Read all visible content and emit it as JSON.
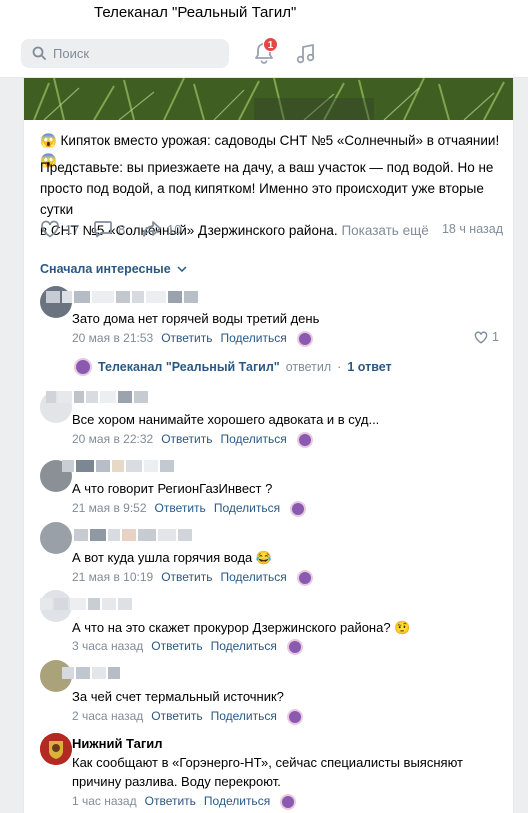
{
  "window": {
    "title": "Телеканал \"Реальный Тагил\""
  },
  "header": {
    "search_placeholder": "Поиск",
    "notifications_count": "1",
    "icons": [
      "search-icon",
      "bell-icon",
      "music-icon"
    ]
  },
  "post": {
    "title": "😱 Кипяток вместо урожая: садоводы СНТ №5 «Солнечный» в отчаянии! 😱",
    "body_line1": "Представьте: вы приезжаете на дачу, а ваш участок — под водой. Но не",
    "body_line2": "просто под водой, а под кипятком! Именно это происходит уже вторые сутки",
    "body_line3": "в СНТ №5 «Солнечный» Дзержинского района.",
    "more": "Показать ещё",
    "likes": "17",
    "comments": "8",
    "shares": "10",
    "time": "18 ч назад"
  },
  "comments_header": {
    "sort_label": "Сначала интересные"
  },
  "labels": {
    "reply": "Ответить",
    "share": "Поделиться"
  },
  "comments": [
    {
      "text": "Зато дома нет горячей воды третий день",
      "date": "20 мая в 21:53",
      "likes": "1"
    },
    {
      "text": "Все хором нанимайте хорошего адвоката и в суд...",
      "date": "20 мая в 22:32"
    },
    {
      "text": "А что говорит РегионГазИнвест ?",
      "date": "21 мая в 9:52"
    },
    {
      "text": "А вот куда ушла горячия вода 😂",
      "date": "21 мая в 10:19"
    },
    {
      "text": "А что на это скажет прокурор Дзержинского района? 🤨",
      "date": "3 часа назад"
    },
    {
      "text": "За чей счет термальный источник?",
      "date": "2 часа назад"
    },
    {
      "author": "Нижний Тагил",
      "text_line1": "Как сообщают в «Горэнерго-НТ», сейчас специалисты выясняют",
      "text_line2": "причину разлива. Воду перекроют.",
      "date": "1 час назад"
    }
  ],
  "reply_thread": {
    "author": "Телеканал \"Реальный Тагил\"",
    "verb": "ответил",
    "separator": "·",
    "count": "1 ответ"
  },
  "colors": {
    "link": "#2a5885",
    "muted": "#818c99",
    "badge": "#e64646",
    "background": "#edeef0"
  }
}
